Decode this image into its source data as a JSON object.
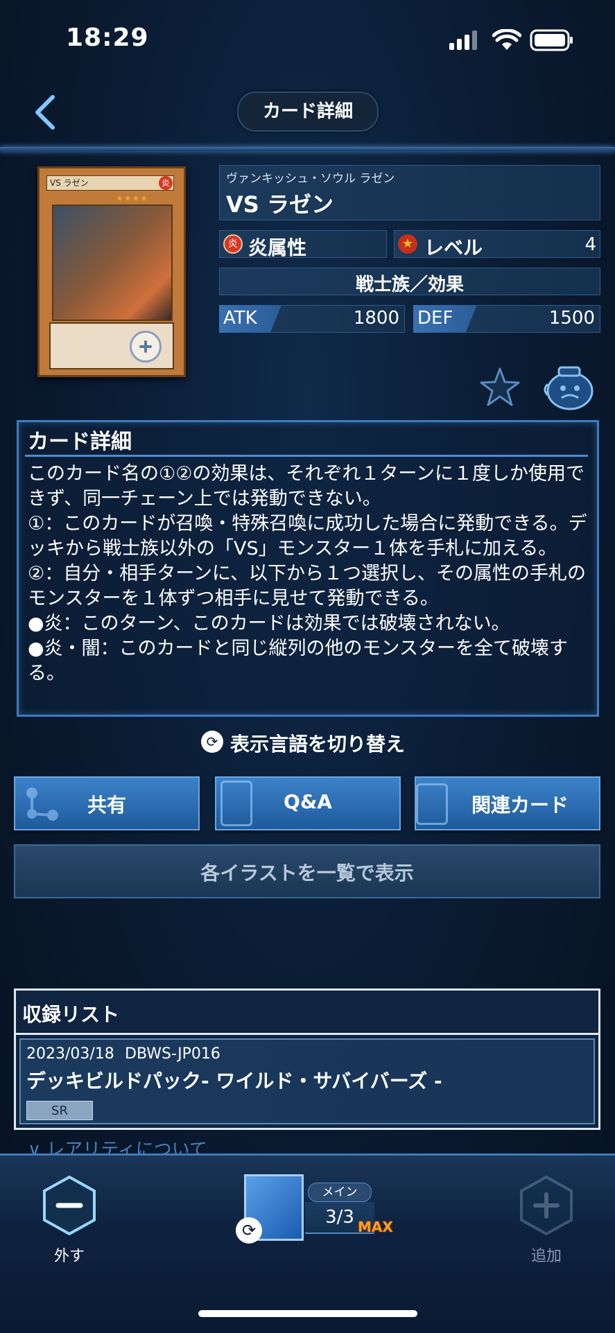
{
  "status": {
    "time": "18:29"
  },
  "header": {
    "title": "カード詳細"
  },
  "card": {
    "image": {
      "name_strip": "VS ラゼン",
      "attribute_glyph": "炎",
      "stars": "★★★★"
    },
    "ruby": "ヴァンキッシュ・ソウル ラゼン",
    "name": "VS ラゼン",
    "attribute": {
      "glyph": "炎",
      "label": "炎属性"
    },
    "level": {
      "label": "レベル",
      "value": "4"
    },
    "type": "戦士族／効果",
    "atk": {
      "label": "ATK",
      "value": "1800"
    },
    "def": {
      "label": "DEF",
      "value": "1500"
    }
  },
  "description": {
    "heading": "カード詳細",
    "text": "このカード名の①②の効果は、それぞれ１ターンに１度しか使用できず、同一チェーン上では発動できない。\n①：このカードが召喚・特殊召喚に成功した場合に発動できる。デッキから戦士族以外の「VS」モンスター１体を手札に加える。\n②：自分・相手ターンに、以下から１つ選択し、その属性の手札のモンスターを１体ずつ相手に見せて発動できる。\n●炎：このターン、このカードは効果では破壊されない。\n●炎・闇：このカードと同じ縦列の他のモンスターを全て破壊する。"
  },
  "language_toggle": {
    "label": "表示言語を切り替え"
  },
  "actions": {
    "share": "共有",
    "qa": "Q&A",
    "related": "関連カード",
    "illustrations": "各イラストを一覧で表示"
  },
  "release_list": {
    "heading": "収録リスト",
    "items": [
      {
        "date": "2023/03/18",
        "code": "DBWS-JP016",
        "pack": "デッキビルドパック- ワイルド・サバイバーズ -",
        "rarity": "SR"
      }
    ],
    "rarity_about": "∨ レアリティについて"
  },
  "bottom_bar": {
    "remove": "外す",
    "add": "追加",
    "deck": {
      "name": "メイン",
      "count": "3/3",
      "max": "MAX"
    }
  },
  "colors": {
    "accent": "#3f7bc0",
    "fire": "#d23a22",
    "max": "#f5a022"
  }
}
